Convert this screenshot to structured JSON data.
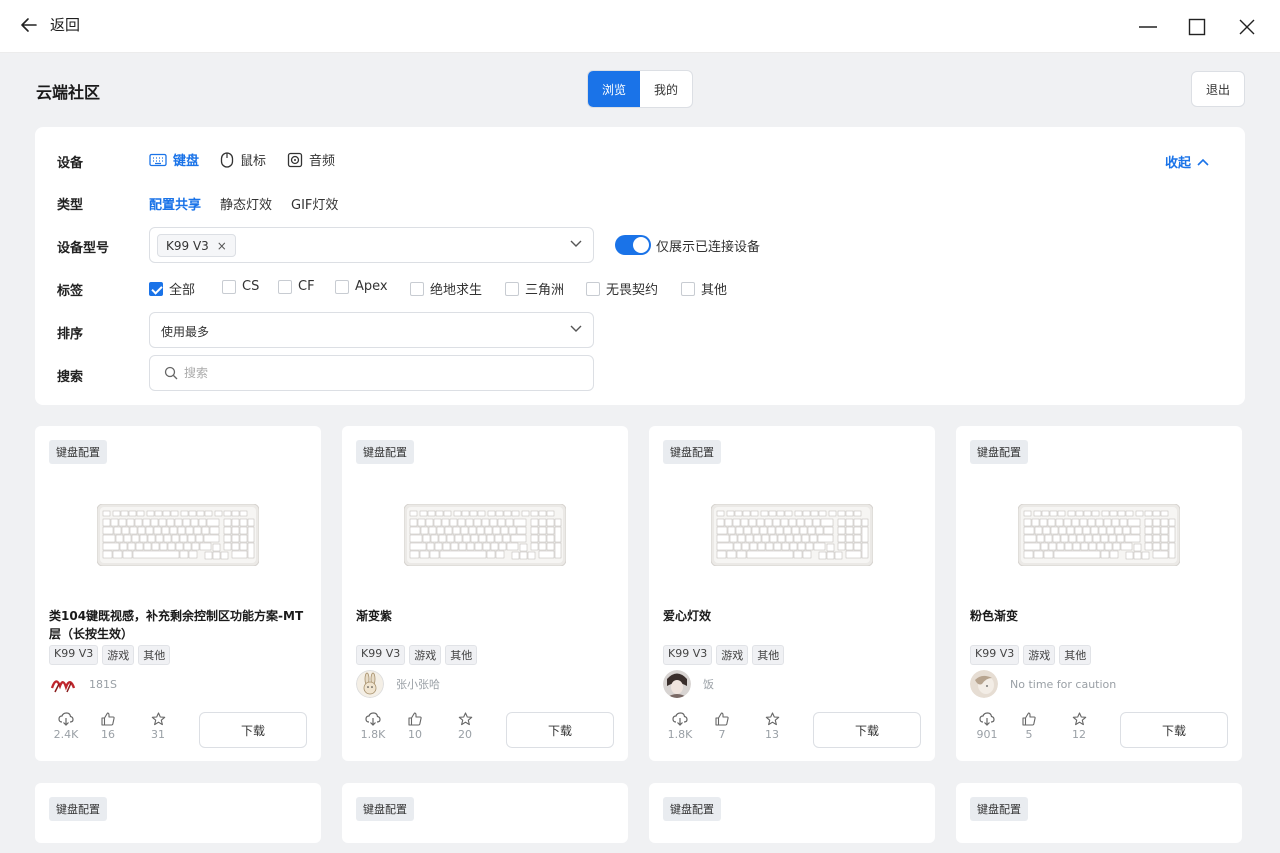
{
  "titlebar": {
    "back_label": "返回"
  },
  "header": {
    "title": "云端社区",
    "segments": [
      "浏览",
      "我的"
    ],
    "exit_label": "退出"
  },
  "filters": {
    "device_label": "设备",
    "devices": [
      {
        "label": "键盘",
        "icon": "keyboard-icon",
        "active": true
      },
      {
        "label": "鼠标",
        "icon": "mouse-icon",
        "active": false
      },
      {
        "label": "音频",
        "icon": "speaker-icon",
        "active": false
      }
    ],
    "collapse_label": "收起",
    "type_label": "类型",
    "types": [
      "配置共享",
      "静态灯效",
      "GIF灯效"
    ],
    "model_label": "设备型号",
    "model_chip": "K99 V3",
    "model_chip_close": "×",
    "toggle_label": "仅展示已连接设备",
    "toggle_on": true,
    "tag_label": "标签",
    "tags": [
      {
        "label": "全部",
        "checked": true
      },
      {
        "label": "CS",
        "checked": false
      },
      {
        "label": "CF",
        "checked": false
      },
      {
        "label": "Apex",
        "checked": false
      },
      {
        "label": "绝地求生",
        "checked": false
      },
      {
        "label": "三角洲",
        "checked": false
      },
      {
        "label": "无畏契约",
        "checked": false
      },
      {
        "label": "其他",
        "checked": false
      }
    ],
    "sort_label": "排序",
    "sort_value": "使用最多",
    "search_label": "搜索",
    "search_placeholder": "搜索"
  },
  "cards": [
    {
      "badge": "键盘配置",
      "title": "类104键既视感，补充剩余控制区功能方案-MT层（长按生效）",
      "tags": [
        "K99 V3",
        "游戏",
        "其他"
      ],
      "author": "181S",
      "downloads": "2.4K",
      "likes": "16",
      "favorites": "31",
      "download_label": "下载"
    },
    {
      "badge": "键盘配置",
      "title": "渐变紫",
      "tags": [
        "K99 V3",
        "游戏",
        "其他"
      ],
      "author": "张小张哈",
      "downloads": "1.8K",
      "likes": "10",
      "favorites": "20",
      "download_label": "下载"
    },
    {
      "badge": "键盘配置",
      "title": "爱心灯效",
      "tags": [
        "K99 V3",
        "游戏",
        "其他"
      ],
      "author": "饭",
      "downloads": "1.8K",
      "likes": "7",
      "favorites": "13",
      "download_label": "下载"
    },
    {
      "badge": "键盘配置",
      "title": "粉色渐变",
      "tags": [
        "K99 V3",
        "游戏",
        "其他"
      ],
      "author": "No time for caution",
      "downloads": "901",
      "likes": "5",
      "favorites": "12",
      "download_label": "下载"
    }
  ],
  "second_row_badges": [
    "键盘配置",
    "键盘配置",
    "键盘配置",
    "键盘配置"
  ],
  "colors": {
    "accent": "#1a73e8",
    "background": "#f0f1f3",
    "card": "#ffffff"
  }
}
